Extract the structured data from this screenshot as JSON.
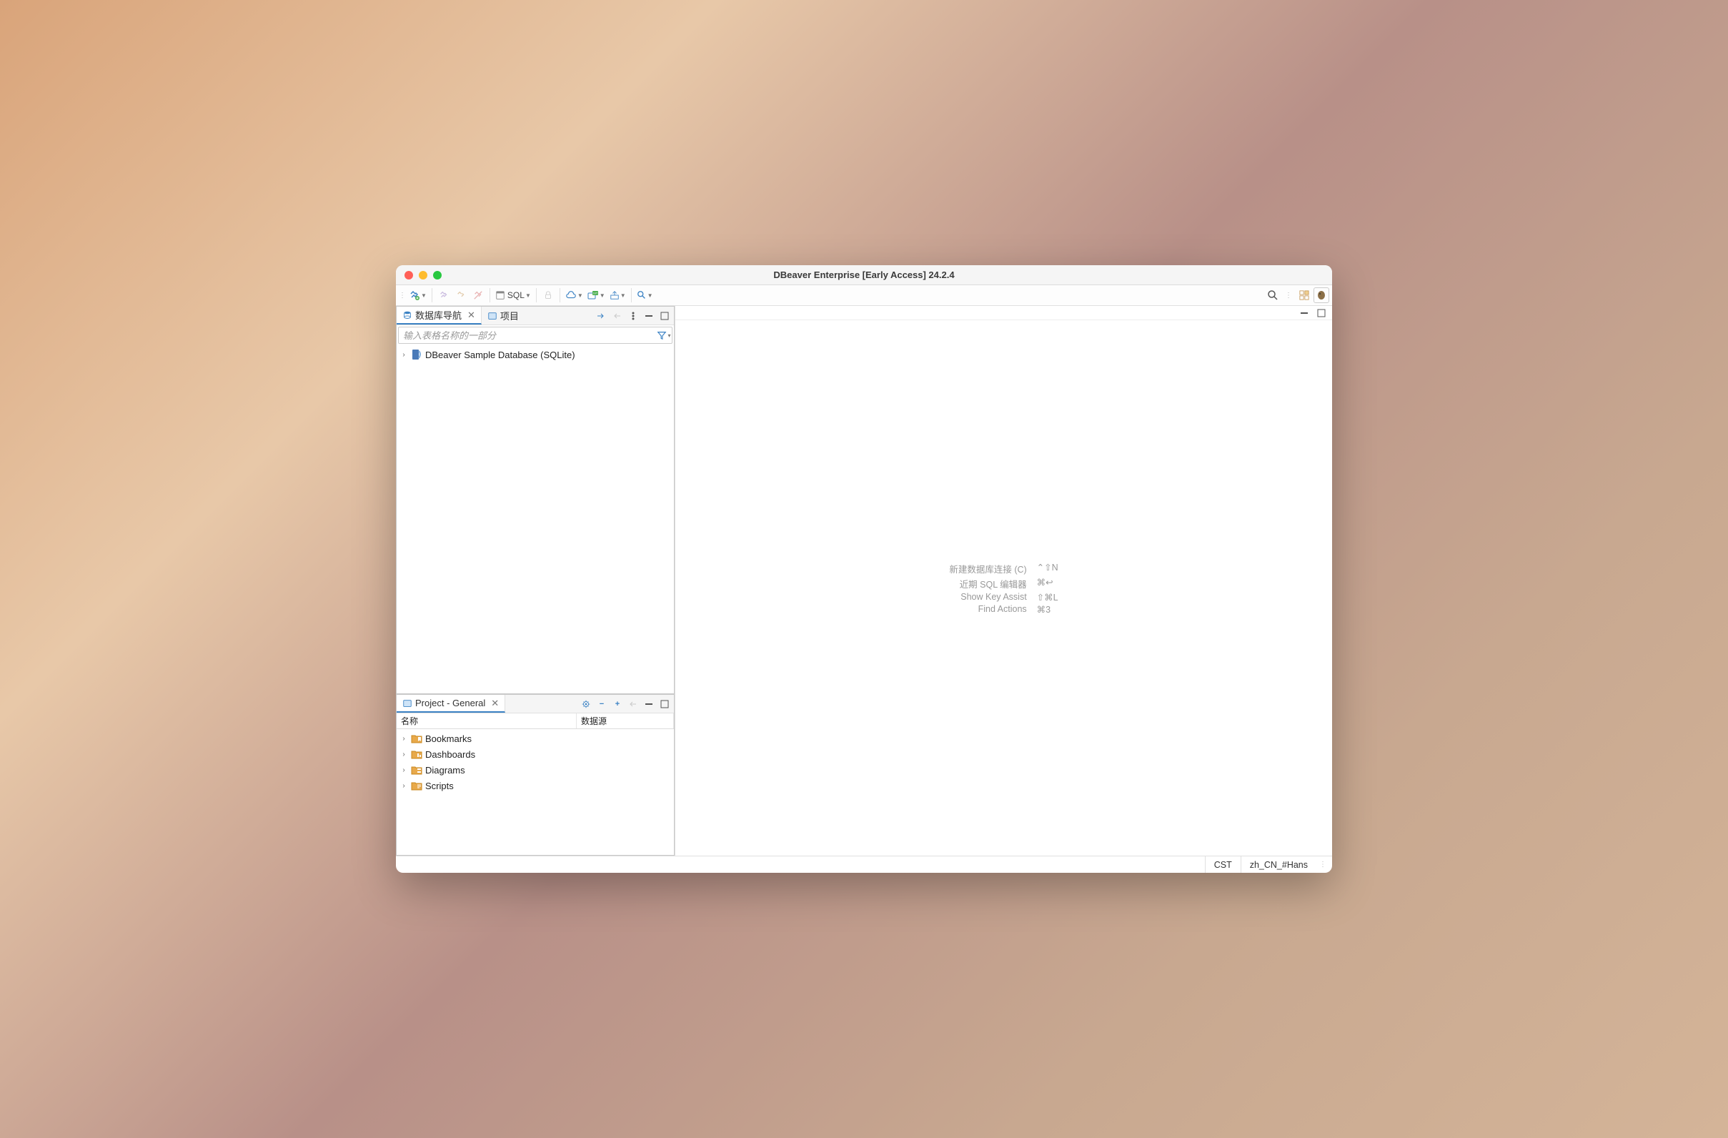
{
  "window": {
    "title": "DBeaver Enterprise [Early Access] 24.2.4"
  },
  "toolbar": {
    "sql_label": "SQL"
  },
  "nav_tabs": {
    "db_nav": "数据库导航",
    "project": "项目"
  },
  "search": {
    "placeholder": "输入表格名称的一部分"
  },
  "db_tree": {
    "items": [
      {
        "label": "DBeaver Sample Database (SQLite)"
      }
    ]
  },
  "project_panel": {
    "tab": "Project - General",
    "columns": {
      "name": "名称",
      "datasource": "数据源"
    },
    "items": [
      {
        "label": "Bookmarks"
      },
      {
        "label": "Dashboards"
      },
      {
        "label": "Diagrams"
      },
      {
        "label": "Scripts"
      }
    ]
  },
  "empty_shortcuts": [
    {
      "label": "新建数据库连接 (C)",
      "key": "⌃⇧N"
    },
    {
      "label": "近期 SQL 编辑器",
      "key": "⌘↩"
    },
    {
      "label": "Show Key Assist",
      "key": "⇧⌘L"
    },
    {
      "label": "Find Actions",
      "key": "⌘3"
    }
  ],
  "statusbar": {
    "tz": "CST",
    "locale": "zh_CN_#Hans"
  }
}
